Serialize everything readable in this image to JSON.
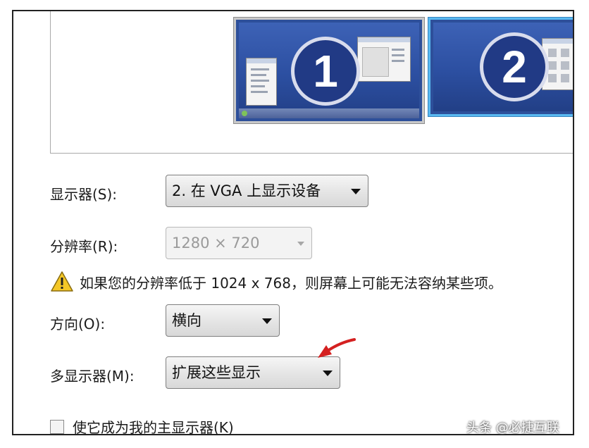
{
  "preview": {
    "monitor_1_number": "1",
    "monitor_2_number": "2"
  },
  "display": {
    "label": "显示器(S):",
    "value": "2. 在 VGA 上显示设备"
  },
  "resolution": {
    "label": "分辨率(R):",
    "value": "1280 × 720"
  },
  "warning": {
    "icon": "warning-icon",
    "text": "如果您的分辨率低于 1024 x 768，则屏幕上可能无法容纳某些项。"
  },
  "orientation": {
    "label": "方向(O):",
    "value": "横向"
  },
  "multiple_displays": {
    "label": "多显示器(M):",
    "value": "扩展这些显示"
  },
  "primary_checkbox": {
    "label": "使它成为我的主显示器(K)",
    "checked": false
  },
  "watermark": "头条 @必捷互联",
  "colors": {
    "selected_monitor_border": "#59b9f0",
    "annotation_arrow": "#d42020",
    "screen_blue": "#2d4f9a"
  }
}
